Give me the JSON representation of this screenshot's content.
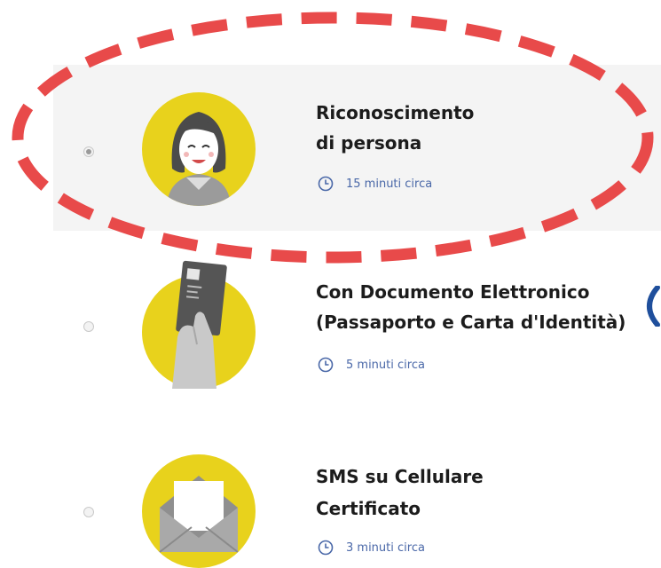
{
  "options": [
    {
      "title_line1": "Riconoscimento",
      "title_line2": "di persona",
      "time": "15 minuti circa",
      "icon": "person-avatar-icon",
      "selected": true
    },
    {
      "title_line1": "Con Documento Elettronico",
      "title_line2": "(Passaporto e Carta d'Identità)",
      "time": "5 minuti circa",
      "icon": "id-card-hand-icon",
      "selected": false
    },
    {
      "title_line1": "SMS su Cellulare",
      "title_line2": "Certificato",
      "time": "3 minuti circa",
      "icon": "envelope-icon",
      "selected": false
    }
  ],
  "colors": {
    "accent_yellow": "#e8d21c",
    "annotation_red": "#e84a4a",
    "time_blue": "#4a68a8",
    "selected_bg": "#f4f4f4"
  }
}
